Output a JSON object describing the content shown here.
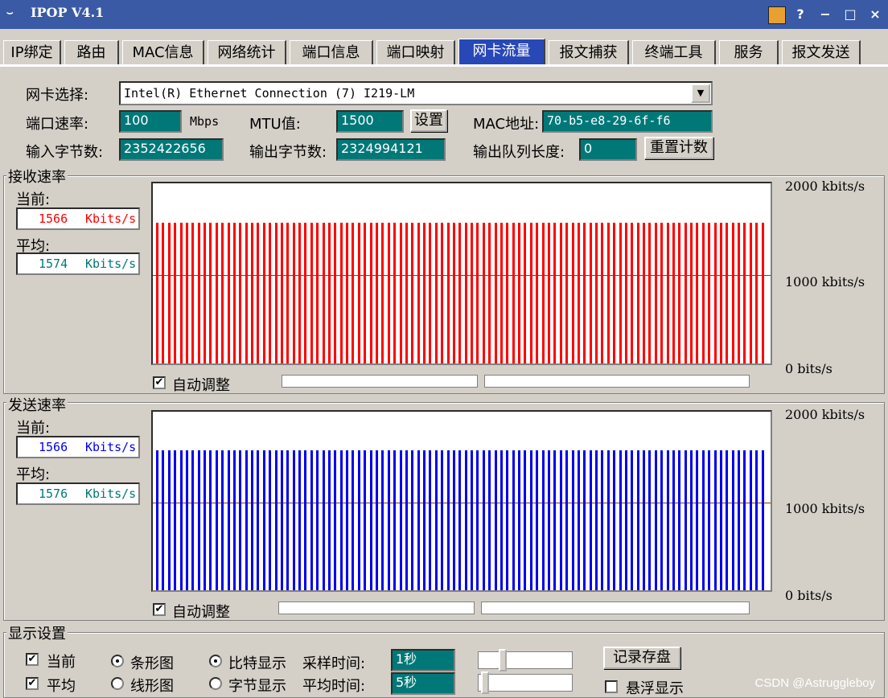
{
  "window": {
    "title": "IPOP V4.1",
    "help": "?",
    "minimize": "−",
    "maximize": "□",
    "close": "×"
  },
  "tabs": [
    {
      "label": "IP绑定"
    },
    {
      "label": "路由"
    },
    {
      "label": "MAC信息"
    },
    {
      "label": "网络统计"
    },
    {
      "label": "端口信息"
    },
    {
      "label": "端口映射"
    },
    {
      "label": "网卡流量"
    },
    {
      "label": "报文捕获"
    },
    {
      "label": "终端工具"
    },
    {
      "label": "服务"
    },
    {
      "label": "报文发送"
    }
  ],
  "active_tab": 6,
  "nic": {
    "select_label": "网卡选择:",
    "select_value": "Intel(R) Ethernet Connection (7) I219-LM",
    "speed_label": "端口速率:",
    "speed_value": "100",
    "speed_unit": "Mbps",
    "mtu_label": "MTU值:",
    "mtu_value": "1500",
    "set_button": "设置",
    "mac_label": "MAC地址:",
    "mac_value": "70-b5-e8-29-6f-f6",
    "in_bytes_label": "输入字节数:",
    "in_bytes_value": "2352422656",
    "out_bytes_label": "输出字节数:",
    "out_bytes_value": "2324994121",
    "queue_label": "输出队列长度:",
    "queue_value": "0",
    "reset_button": "重置计数"
  },
  "recv": {
    "title": "接收速率",
    "current_label": "当前:",
    "current_value": "1566",
    "current_unit": "Kbits/s",
    "avg_label": "平均:",
    "avg_value": "1574",
    "avg_unit": "Kbits/s",
    "auto_adjust": "自动调整",
    "color": "#ff0000",
    "axis": [
      "2000  kbits/s",
      "1000  kbits/s",
      "0   bits/s"
    ]
  },
  "send": {
    "title": "发送速率",
    "current_label": "当前:",
    "current_value": "1566",
    "current_unit": "Kbits/s",
    "avg_label": "平均:",
    "avg_value": "1576",
    "avg_unit": "Kbits/s",
    "auto_adjust": "自动调整",
    "color": "#0000ee",
    "axis": [
      "2000  kbits/s",
      "1000  kbits/s",
      "0   bits/s"
    ]
  },
  "display": {
    "title": "显示设置",
    "current": "当前",
    "average": "平均",
    "bar_chart": "条形图",
    "line_chart": "线形图",
    "bit_display": "比特显示",
    "byte_display": "字节显示",
    "sample_label": "采样时间:",
    "sample_value": "1秒",
    "avg_time_label": "平均时间:",
    "avg_time_value": "5秒",
    "save_button": "记录存盘",
    "float_display": "悬浮显示"
  },
  "watermark": "CSDN @Astruggleboy",
  "chart_data": [
    {
      "type": "bar",
      "title": "接收速率",
      "ylim": [
        0,
        2000
      ],
      "unit": "kbits/s",
      "values_kbps": [
        1566
      ],
      "bar_count": 103,
      "series": [
        {
          "name": "当前",
          "values": [
            1566
          ]
        }
      ],
      "average": 1574
    },
    {
      "type": "bar",
      "title": "发送速率",
      "ylim": [
        0,
        2000
      ],
      "unit": "kbits/s",
      "values_kbps": [
        1566
      ],
      "bar_count": 103,
      "series": [
        {
          "name": "当前",
          "values": [
            1566
          ]
        }
      ],
      "average": 1576
    }
  ]
}
